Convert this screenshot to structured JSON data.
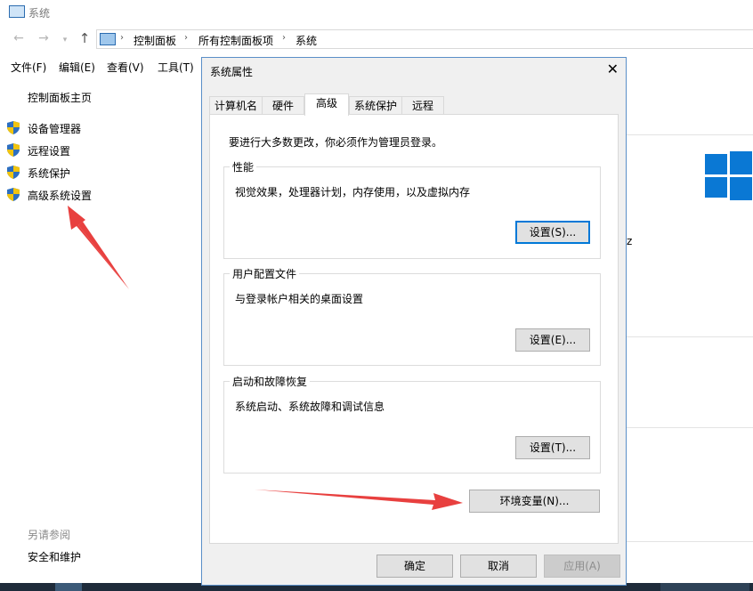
{
  "window": {
    "title": "系统",
    "breadcrumb": [
      "控制面板",
      "所有控制面板项",
      "系统"
    ]
  },
  "menu": [
    "文件(F)",
    "编辑(E)",
    "查看(V)",
    "工具(T)"
  ],
  "left_pane": {
    "home": "控制面板主页",
    "items": [
      {
        "label": "设备管理器",
        "icon": "shield-icon"
      },
      {
        "label": "远程设置",
        "icon": "shield-icon"
      },
      {
        "label": "系统保护",
        "icon": "shield-icon"
      },
      {
        "label": "高级系统设置",
        "icon": "shield-icon"
      }
    ],
    "see_also": "另请参阅",
    "security": "安全和维护"
  },
  "right_bg": {
    "fragment": "z"
  },
  "dialog": {
    "title": "系统属性",
    "tabs": [
      "计算机名",
      "硬件",
      "高级",
      "系统保护",
      "远程"
    ],
    "active_tab": "高级",
    "notice": "要进行大多数更改，你必须作为管理员登录。",
    "performance": {
      "title": "性能",
      "desc": "视觉效果，处理器计划，内存使用，以及虚拟内存",
      "button": "设置(S)..."
    },
    "profiles": {
      "title": "用户配置文件",
      "desc": "与登录帐户相关的桌面设置",
      "button": "设置(E)..."
    },
    "startup": {
      "title": "启动和故障恢复",
      "desc": "系统启动、系统故障和调试信息",
      "button": "设置(T)..."
    },
    "env_button": "环境变量(N)...",
    "ok": "确定",
    "cancel": "取消",
    "apply": "应用(A)"
  },
  "colors": {
    "accent": "#0078d7",
    "annotation_arrow": "#e8403f",
    "windows_logo": "#0a78d4"
  }
}
